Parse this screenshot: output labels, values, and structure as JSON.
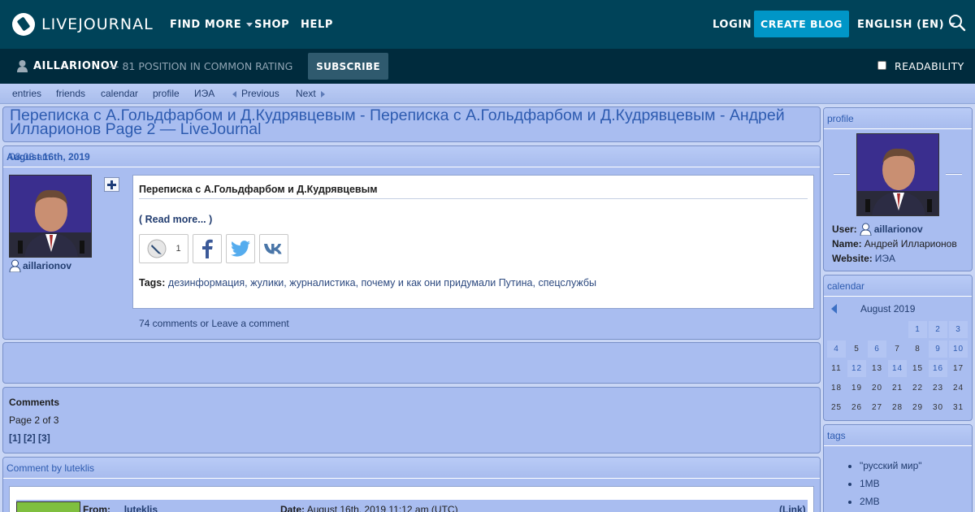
{
  "header": {
    "logo_text": "LIVEJOURNAL",
    "nav": [
      "FIND MORE",
      "SHOP",
      "HELP"
    ],
    "login": "LOGIN",
    "create_blog": "CREATE BLOG",
    "language": "ENGLISH (EN)",
    "colors": {
      "bar": "#004359",
      "accent": "#0096c7"
    }
  },
  "journal_bar": {
    "username": "AILLARIONOV",
    "rating": "— 81 POSITION IN COMMON RATING",
    "subscribe": "SUBSCRIBE",
    "readability": "READABILITY"
  },
  "subnav": {
    "links": [
      "entries",
      "friends",
      "calendar",
      "profile",
      "ИЭА"
    ],
    "previous": "Previous",
    "next": "Next"
  },
  "page_title": "Переписка с А.Гольдфарбом и Д.Кудрявцевым - Переписка с А.Гольдфарбом и Д.Кудрявцевым - Андрей Илларионов Page 2 — LiveJournal",
  "post": {
    "time": "08:03 am",
    "date": "August 16th, 2019",
    "author": "aillarionov",
    "subject": "Переписка с А.Гольдфарбом и Д.Кудрявцевым",
    "read_more": "( Read more... )",
    "share_count": "1",
    "tags_label": "Tags:",
    "tags": "дезинформация, жулики, журналистика, почему и как они придумали Путина, спецслужбы",
    "comments_count": "74 comments",
    "comments_sep": " or ",
    "leave_comment": "Leave a comment"
  },
  "comments_box": {
    "heading": "Comments",
    "page_info": "Page 2 of 3",
    "pages": [
      "[1]",
      "[2]",
      "[3]"
    ]
  },
  "comment": {
    "head": "Comment by luteklis",
    "from_label": "From:",
    "from_user": "luteklis",
    "date_label": "Date:",
    "date": "August 16th, 2019 11:12 am (UTC)",
    "link": "(Link)"
  },
  "sidebar": {
    "profile": {
      "head": "profile",
      "user_label": "User:",
      "user": "aillarionov",
      "name_label": "Name:",
      "name": "Андрей Илларионов",
      "website_label": "Website:",
      "website": "ИЭА"
    },
    "calendar": {
      "head": "calendar",
      "month": "August 2019",
      "days": [
        "",
        "",
        "",
        "",
        "1",
        "2",
        "3",
        "4",
        "5",
        "6",
        "7",
        "8",
        "9",
        "10",
        "11",
        "12",
        "13",
        "14",
        "15",
        "16",
        "17",
        "18",
        "19",
        "20",
        "21",
        "22",
        "23",
        "24",
        "25",
        "26",
        "27",
        "28",
        "29",
        "30",
        "31"
      ],
      "active_days": [
        "1",
        "2",
        "3",
        "4",
        "6",
        "9",
        "10",
        "12",
        "14",
        "16"
      ]
    },
    "tags": {
      "head": "tags",
      "items": [
        "\"русский мир\"",
        "1MB",
        "2MB"
      ]
    }
  }
}
